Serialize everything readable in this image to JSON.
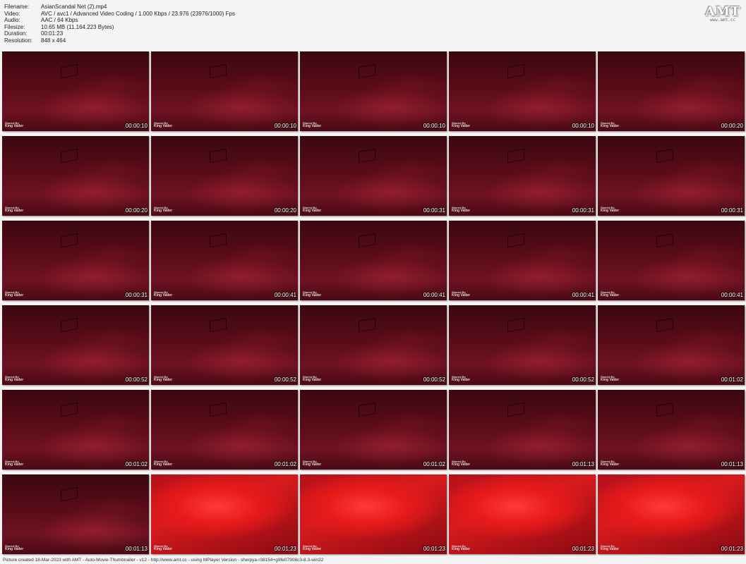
{
  "meta": {
    "filename_label": "Filename:",
    "filename": "AsianScandal Net (2).mp4",
    "video_label": "Video:",
    "video": "AVC / avc1 / Advanced Video Coding / 1.000 Kbps / 23.976 (23976/1000) Fps",
    "audio_label": "Audio:",
    "audio": "AAC / 64 Kbps",
    "filesize_label": "Filesize:",
    "filesize": "10.65 MB (11.164.223 Bytes)",
    "duration_label": "Duration:",
    "duration": "00:01:23",
    "resolution_label": "Resolution:",
    "resolution": "848 x 464"
  },
  "logo": {
    "text": "AMT",
    "url": "www.amt.cc"
  },
  "watermark": {
    "line1": "Shared By",
    "line2": "King Vader"
  },
  "thumbnails": [
    {
      "time": "00:00:10",
      "style": "dark"
    },
    {
      "time": "00:00:10",
      "style": "dark"
    },
    {
      "time": "00:00:10",
      "style": "dark"
    },
    {
      "time": "00:00:10",
      "style": "dark"
    },
    {
      "time": "00:00:20",
      "style": "dark"
    },
    {
      "time": "00:00:20",
      "style": "dark"
    },
    {
      "time": "00:00:20",
      "style": "dark"
    },
    {
      "time": "00:00:31",
      "style": "dark"
    },
    {
      "time": "00:00:31",
      "style": "dark"
    },
    {
      "time": "00:00:31",
      "style": "dark"
    },
    {
      "time": "00:00:31",
      "style": "dark"
    },
    {
      "time": "00:00:41",
      "style": "dark"
    },
    {
      "time": "00:00:41",
      "style": "dark"
    },
    {
      "time": "00:00:41",
      "style": "dark"
    },
    {
      "time": "00:00:41",
      "style": "dark"
    },
    {
      "time": "00:00:52",
      "style": "dark"
    },
    {
      "time": "00:00:52",
      "style": "dark"
    },
    {
      "time": "00:00:52",
      "style": "dark"
    },
    {
      "time": "00:00:52",
      "style": "dark"
    },
    {
      "time": "00:01:02",
      "style": "dark"
    },
    {
      "time": "00:01:02",
      "style": "dark"
    },
    {
      "time": "00:01:02",
      "style": "dark"
    },
    {
      "time": "00:01:02",
      "style": "dark"
    },
    {
      "time": "00:01:13",
      "style": "dark"
    },
    {
      "time": "00:01:13",
      "style": "dark"
    },
    {
      "time": "00:01:13",
      "style": "dark"
    },
    {
      "time": "00:01:23",
      "style": "bright"
    },
    {
      "time": "00:01:23",
      "style": "bright"
    },
    {
      "time": "00:01:23",
      "style": "bright"
    },
    {
      "time": "00:01:23",
      "style": "bright"
    }
  ],
  "footer": "Picture created 18-Mar-2023 with AMT - Auto-Movie-Thumbnailer - v12 - http://www.amt.cc - using MPlayer Version - sherpya-r38154+g9fe07908c3-8.3-win32"
}
